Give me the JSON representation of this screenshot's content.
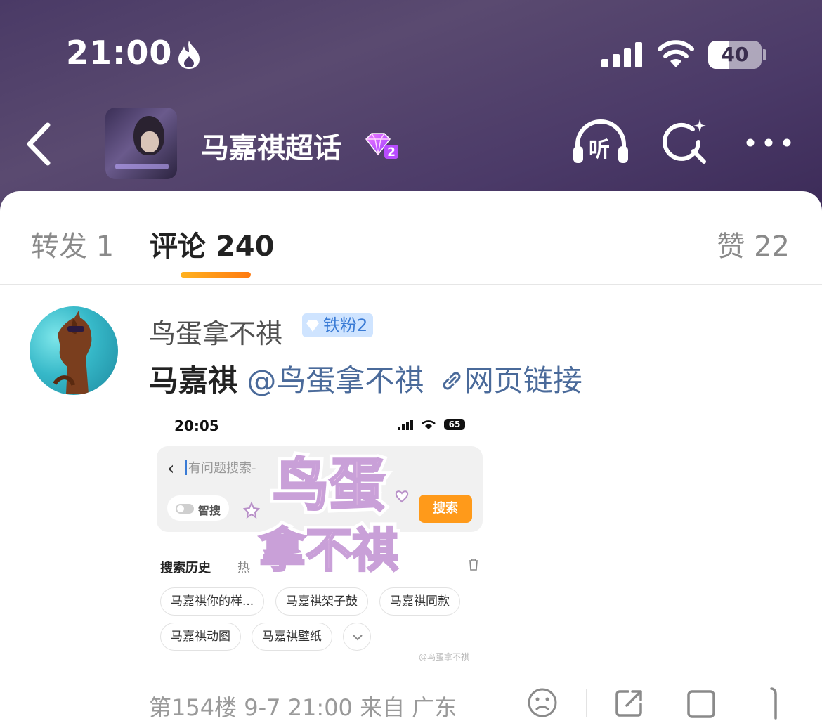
{
  "status_bar": {
    "time": "21:00",
    "battery": "40",
    "battery_level": 0.4
  },
  "nav": {
    "title": "马嘉祺超话",
    "gem_level": "2",
    "listen_label": "听",
    "icons": [
      "back-icon",
      "headphones-icon",
      "sparkle-search-icon",
      "more-icon"
    ]
  },
  "tabs": {
    "repost": "转发 1",
    "comment": "评论 240",
    "like": "赞 22"
  },
  "comment": {
    "username": "鸟蛋拿不祺",
    "fan_badge": "铁粉2",
    "text_bold": "马嘉祺",
    "mention": "@鸟蛋拿不祺",
    "link": "网页链接",
    "meta": "第154楼 9-7 21:00 来自 广东"
  },
  "screenshot": {
    "time": "20:05",
    "battery": "65",
    "search_placeholder": "有问题搜索-",
    "smart_search_label": "智搜",
    "search_button": "搜索",
    "history_label": "搜索历史",
    "hot_label": "热",
    "chips": [
      "马嘉祺你的样...",
      "马嘉祺架子鼓",
      "马嘉祺同款",
      "马嘉祺动图",
      "马嘉祺壁纸"
    ],
    "watermark": "@鸟蛋拿不祺",
    "sticker_line1": "鸟蛋",
    "sticker_line2": "拿不祺"
  },
  "colors": {
    "header_bg": "#4a3a66",
    "accent_orange": "#ff9a1a",
    "mention_blue": "#4a6a9a",
    "badge_blue": "#3a7bd5"
  }
}
